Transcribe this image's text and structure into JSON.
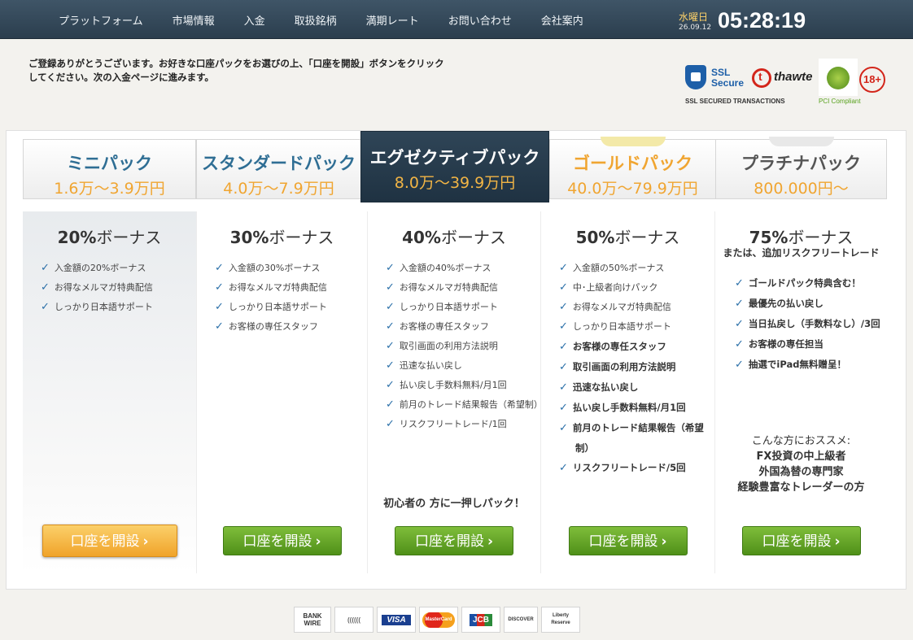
{
  "nav": {
    "items": [
      "プラットフォーム",
      "市場情報",
      "入金",
      "取扱銘柄",
      "満期レート",
      "お問い合わせ",
      "会社案内"
    ]
  },
  "clock": {
    "day": "水曜日",
    "date": "26.09.12",
    "time": "05:28:19"
  },
  "intro": "ご登録ありがとうございます。お好きな口座パックをお選びの上、「口座を開設」ボタンをクリックしてください。次の入金ページに進みます。",
  "badges": {
    "ssl_line1": "SSL",
    "ssl_line2": "Secure",
    "ssl_caption": "SSL SECURED TRANSACTIONS",
    "thawte": "thawte",
    "pci_caption": "PCI Compliant",
    "age": "18+"
  },
  "packs": [
    {
      "name": "ミニパック",
      "price": "1.6万～3.9万円",
      "bonus_pct": "20%",
      "bonus_word": "ボーナス",
      "features": [
        "入金額の20%ボーナス",
        "お得なメルマガ特典配信",
        "しっかり日本語サポート"
      ],
      "button": "口座を開設"
    },
    {
      "name": "スタンダードパック",
      "price": "4.0万～7.9万円",
      "bonus_pct": "30%",
      "bonus_word": "ボーナス",
      "features": [
        "入金額の30%ボーナス",
        "お得なメルマガ特典配信",
        "しっかり日本語サポート",
        "お客様の専任スタッフ"
      ],
      "button": "口座を開設"
    },
    {
      "name": "エグゼクティブパック",
      "price": "8.0万～39.9万円",
      "bonus_pct": "40%",
      "bonus_word": "ボーナス",
      "features": [
        "入金額の40%ボーナス",
        "お得なメルマガ特典配信",
        "しっかり日本語サポート",
        "お客様の専任スタッフ",
        "取引画面の利用方法説明",
        "迅速な払い戻し",
        "払い戻し手数料無料/月1回",
        "前月のトレード結果報告（希望制）",
        "リスクフリートレード/1回"
      ],
      "tagline": "初心者の 方に一押しパック！",
      "button": "口座を開設"
    },
    {
      "name": "ゴールドパック",
      "price": "40.0万～79.9万円",
      "bonus_pct": "50%",
      "bonus_word": "ボーナス",
      "features": [
        "入金額の50%ボーナス",
        "中･上級者向けパック",
        "お得なメルマガ特典配信",
        "しっかり日本語サポート",
        "お客様の専任スタッフ",
        "取引画面の利用方法説明",
        "迅速な払い戻し",
        "払い戻し手数料無料/月1回",
        "前月のトレード結果報告（希望",
        "制）",
        "リスクフリートレード/5回"
      ],
      "button": "口座を開設"
    },
    {
      "name": "プラチナパック",
      "price": "800.000円～",
      "bonus_pct": "75%",
      "bonus_word": "ボーナス",
      "sub": "または、追加リスクフリートレード",
      "features": [
        "ゴールドパック特典含む！",
        "最優先の払い戻し",
        "当日払戻し（手数料なし）/3回",
        "お客様の専任担当",
        "抽選でiPad無料贈呈！"
      ],
      "rec_heading": "こんな方におススメ:",
      "rec_lines": [
        "FX投資の中上級者",
        "外国為替の専門家",
        "経験豊富なトレーダーの方"
      ],
      "button": "口座を開設"
    }
  ],
  "payments": {
    "bank": [
      "BANK",
      "WIRE"
    ],
    "moneybookers": "((((((",
    "visa": "VISA",
    "mastercard": "MasterCard",
    "jcb": "JCB",
    "discover": "DISCOVER",
    "liberty": [
      "Liberty",
      "Reserve"
    ]
  },
  "colors": {
    "nav_bg": "#2f4557",
    "accent_orange": "#f0a531",
    "accent_blue": "#2f6e94",
    "button_green": "#5f9f22"
  }
}
